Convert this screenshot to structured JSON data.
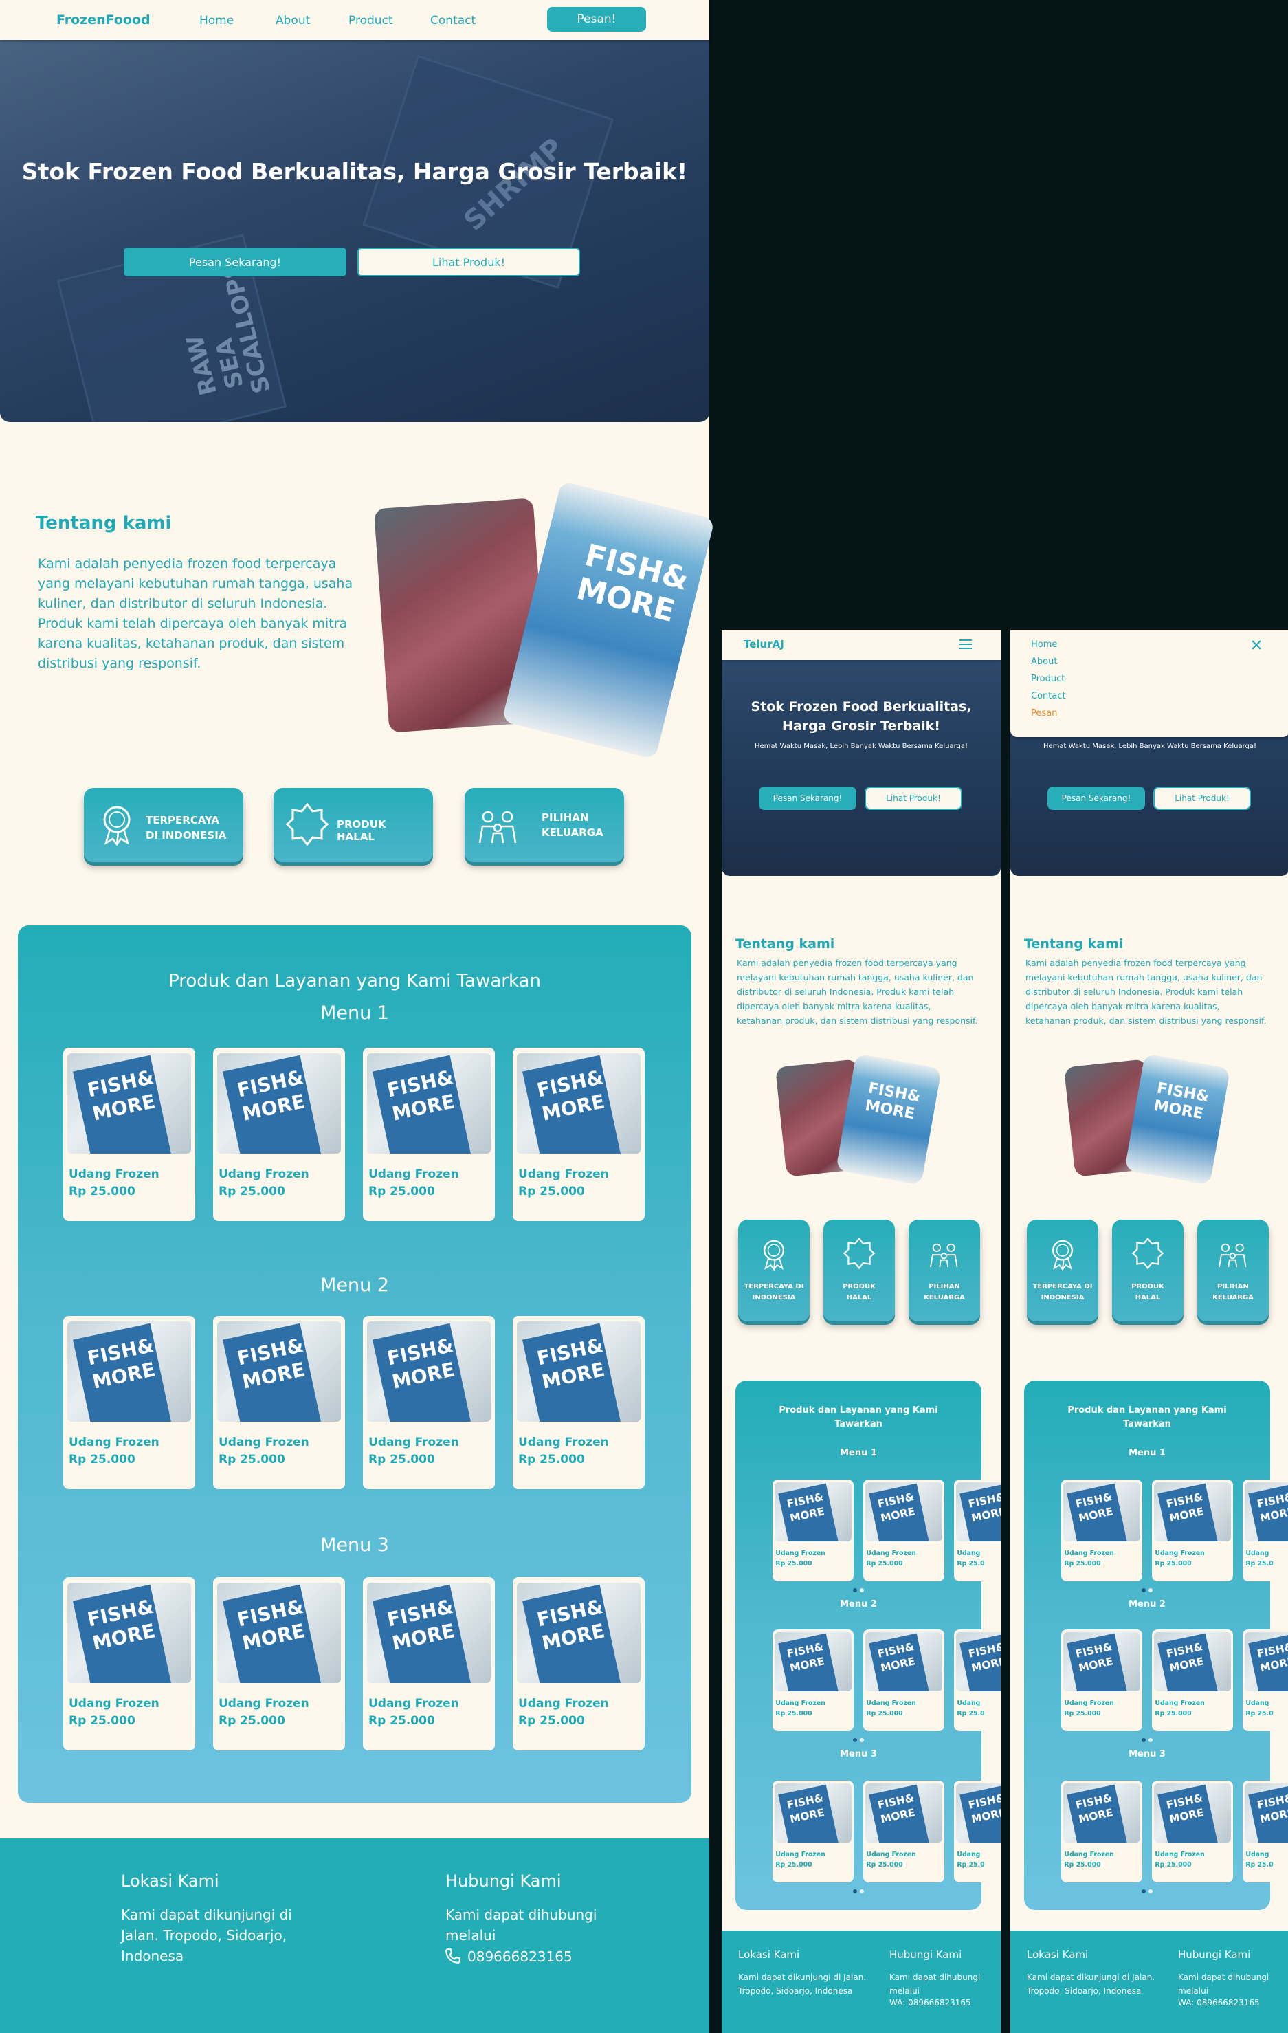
{
  "desktop": {
    "brand": "FrozenFoood",
    "nav": [
      "Home",
      "About",
      "Product",
      "Contact"
    ],
    "nav_button": "Pesan!",
    "hero": {
      "title": "Stok Frozen Food Berkualitas, Harga Grosir Terbaik!",
      "btn_primary": "Pesan Sekarang!",
      "btn_secondary": "Lihat Produk!"
    },
    "about": {
      "title": "Tentang kami",
      "text": "Kami adalah penyedia frozen food terpercaya yang melayani kebutuhan rumah tangga, usaha kuliner, dan distributor di seluruh Indonesia. Produk kami telah dipercaya oleh banyak mitra karena kualitas, ketahanan produk, dan sistem distribusi yang responsif."
    },
    "features": [
      "TERPERCAYA DI INDONESIA",
      "PRODUK HALAL",
      "PILIHAN KELUARGA"
    ],
    "products": {
      "title": "Produk dan Layanan yang Kami Tawarkan",
      "menus": [
        "Menu 1",
        "Menu 2",
        "Menu 3"
      ],
      "item_name": "Udang Frozen",
      "item_price": "Rp 25.000"
    },
    "footer": {
      "loc_title": "Lokasi Kami",
      "loc_text": "Kami dapat dikunjungi di Jalan. Tropodo, Sidoarjo, Indonesa",
      "contact_title": "Hubungi Kami",
      "contact_text": "Kami dapat dihubungi melalui",
      "phone": "089666823165"
    }
  },
  "mobile": {
    "brand": "TelurAJ",
    "hero_title": "Stok Frozen Food Berkualitas, Harga Grosir Terbaik!",
    "hero_sub": "Hemat Waktu Masak, Lebih Banyak Waktu Bersama Keluarga!",
    "btn_primary": "Pesan Sekarang!",
    "btn_secondary": "Lihat Produk!",
    "about_title": "Tentang kami",
    "about_text": "Kami adalah penyedia frozen food terpercaya yang melayani kebutuhan rumah tangga, usaha kuliner, dan distributor di seluruh Indonesia. Produk kami telah dipercaya oleh banyak mitra karena kualitas, ketahanan produk, dan sistem distribusi yang responsif.",
    "features": [
      "TERPERCAYA DI INDONESIA",
      "PRODUK HALAL",
      "PILIHAN KELUARGA"
    ],
    "products_title": "Produk dan Layanan yang Kami Tawarkan",
    "menus": [
      "Menu 1",
      "Menu 2",
      "Menu 3"
    ],
    "item_name": "Udang Frozen",
    "item_price": "Rp 25.000",
    "item_name_cut": "Udang",
    "item_price_cut": "Rp 25.0",
    "footer": {
      "loc_title": "Lokasi Kami",
      "loc_text": "Kami dapat dikunjungi di Jalan. Tropodo, Sidoarjo, Indonesa",
      "contact_title": "Hubungi Kami",
      "contact_text": "Kami dapat dihubungi melalui",
      "wa": "WA: 089666823165"
    },
    "menu_open": [
      "Home",
      "About",
      "Product",
      "Contact",
      "Pesan"
    ],
    "hero_title_cut": "Harga Grosir Terbaik!"
  },
  "packaging_text": [
    "FISH&",
    "MORE"
  ],
  "hero_pack_text": [
    "RAW SEA",
    "SCALLOPS",
    "SHRIMP"
  ],
  "colors": {
    "teal": "#1eaab7",
    "cream": "#fdf7ec",
    "hero_dark": "#223958",
    "accent_orange": "#f08a24"
  }
}
